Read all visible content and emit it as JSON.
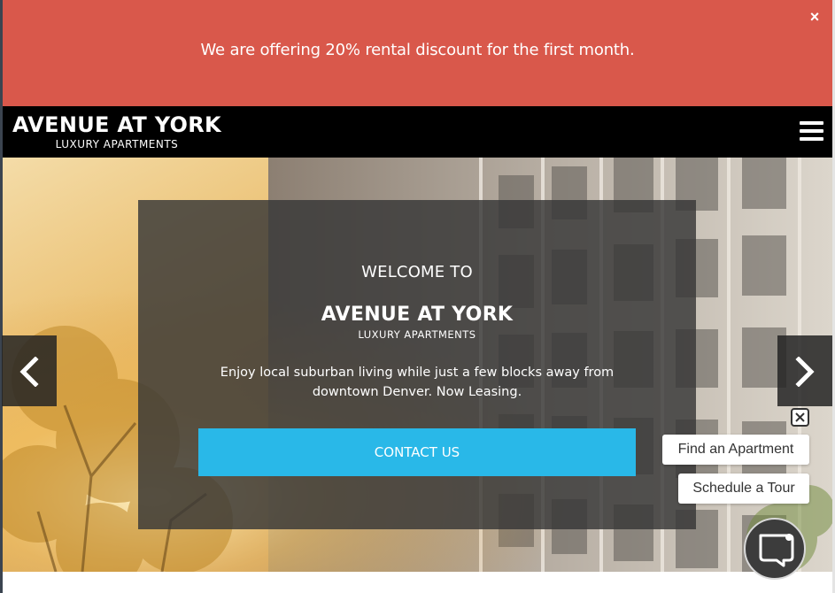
{
  "promo": {
    "text": "We are offering 20% rental discount for the first month.",
    "close_label": "×"
  },
  "header": {
    "logo_main": "AVENUE AT YORK",
    "logo_sub": "LUXURY APARTMENTS",
    "menu_icon": "hamburger-menu-icon"
  },
  "hero": {
    "welcome": "WELCOME TO",
    "logo_main": "AVENUE AT YORK",
    "logo_sub": "LUXURY APARTMENTS",
    "description": "Enjoy local suburban living while just a few blocks away from downtown Denver. Now Leasing.",
    "cta": "CONTACT US",
    "prev_icon": "chevron-left-icon",
    "next_icon": "chevron-right-icon"
  },
  "widget": {
    "find_label": "Find an Apartment",
    "tour_label": "Schedule a Tour",
    "close_icon": "close-icon",
    "chat_icon": "chat-bubble-icon"
  },
  "colors": {
    "promo_bg": "#d9584b",
    "header_bg": "#000000",
    "cta_bg": "#29b8e8",
    "overlay_bg": "rgba(55,55,55,0.82)"
  }
}
